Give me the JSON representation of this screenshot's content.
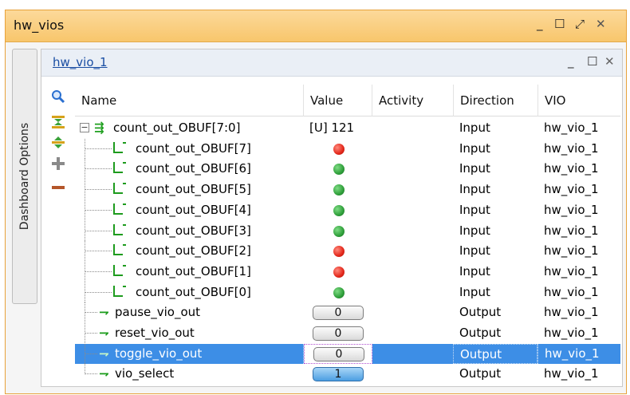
{
  "outer_window": {
    "title": "hw_vios",
    "minimize": "_",
    "maximize": "☐",
    "restore": "⤢",
    "close": "✕"
  },
  "side_tab": {
    "label": "Dashboard Options"
  },
  "inner_window": {
    "title": "hw_vio_1",
    "minimize": "_",
    "maximize": "☐",
    "close": "✕"
  },
  "toolbar": {
    "icons": [
      "search-icon",
      "collapse-all-icon",
      "expand-all-icon",
      "add-icon",
      "remove-icon"
    ],
    "colors": {
      "search": "#2a6fd0",
      "collapse": "#d6a21a",
      "expand": "#3aa23a",
      "add": "#8a8a8a",
      "remove": "#b4562a"
    }
  },
  "table": {
    "columns": [
      "Name",
      "Value",
      "Activity",
      "Direction",
      "VIO"
    ],
    "rows": [
      {
        "name": "count_out_OBUF[7:0]",
        "value": "[U] 121",
        "activity": "",
        "direction": "Input",
        "vio": "hw_vio_1",
        "kind": "bus"
      },
      {
        "name": "count_out_OBUF[7]",
        "value": "",
        "led": "red",
        "activity": "",
        "direction": "Input",
        "vio": "hw_vio_1",
        "kind": "bit"
      },
      {
        "name": "count_out_OBUF[6]",
        "value": "",
        "led": "green",
        "activity": "",
        "direction": "Input",
        "vio": "hw_vio_1",
        "kind": "bit"
      },
      {
        "name": "count_out_OBUF[5]",
        "value": "",
        "led": "green",
        "activity": "",
        "direction": "Input",
        "vio": "hw_vio_1",
        "kind": "bit"
      },
      {
        "name": "count_out_OBUF[4]",
        "value": "",
        "led": "green",
        "activity": "",
        "direction": "Input",
        "vio": "hw_vio_1",
        "kind": "bit"
      },
      {
        "name": "count_out_OBUF[3]",
        "value": "",
        "led": "green",
        "activity": "",
        "direction": "Input",
        "vio": "hw_vio_1",
        "kind": "bit"
      },
      {
        "name": "count_out_OBUF[2]",
        "value": "",
        "led": "red",
        "activity": "",
        "direction": "Input",
        "vio": "hw_vio_1",
        "kind": "bit"
      },
      {
        "name": "count_out_OBUF[1]",
        "value": "",
        "led": "red",
        "activity": "",
        "direction": "Input",
        "vio": "hw_vio_1",
        "kind": "bit"
      },
      {
        "name": "count_out_OBUF[0]",
        "value": "",
        "led": "green",
        "activity": "",
        "direction": "Input",
        "vio": "hw_vio_1",
        "kind": "bit"
      },
      {
        "name": "pause_vio_out",
        "value": "0",
        "activity": "",
        "direction": "Output",
        "vio": "hw_vio_1",
        "kind": "out"
      },
      {
        "name": "reset_vio_out",
        "value": "0",
        "activity": "",
        "direction": "Output",
        "vio": "hw_vio_1",
        "kind": "out"
      },
      {
        "name": "toggle_vio_out",
        "value": "0",
        "activity": "",
        "direction": "Output",
        "vio": "hw_vio_1",
        "kind": "out",
        "selected": true
      },
      {
        "name": "vio_select",
        "value": "1",
        "activity": "",
        "direction": "Output",
        "vio": "hw_vio_1",
        "kind": "out",
        "on": true
      }
    ]
  }
}
